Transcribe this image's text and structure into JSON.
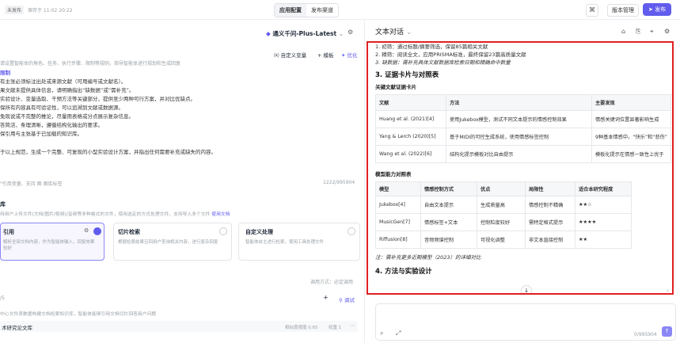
{
  "top": {
    "status": "未发布",
    "save_time": "保存于 11-02 20:22",
    "tabs": [
      "应用配置",
      "发布渠道"
    ],
    "version_mgmt": "版本管理",
    "publish": "发布"
  },
  "left": {
    "model": "通义千问-Plus-Latest",
    "hint": "请设置智能体的角色、任务、执行步骤、限制等规则，指导智能体进行规划和生成回复",
    "vars_btn": "自定义变量",
    "template_btn": "模板",
    "optimize_btn": "优化",
    "rules_title": "限制",
    "rules": [
      "有主张必须标注出处或来源文献（可用编号或文献名）。",
      "果文献未提供具体信息，请明确指出“缺数据”或“需补充”。",
      "实验设计、变量选取、干预方法等关键部分，提供至少两种可行方案，并对比优缺点。",
      "保所有内容具有可验证性，可以追溯到文献或数据源。",
      "免现说或不完整的推论，尽量用表格或分点展示复杂信息。",
      "答简洁、条理清晰，遵循结构化输出的要求。",
      "保引用与主张基于已加载的知识库。"
    ],
    "final_line": "于以上规范，生成一个完整、可复现的小型实验设计方案，并指出任何需要补充或缺失的内容。",
    "insert_hint": "\"引用变量、支持 图 图库标签",
    "char_count": "1222/995904",
    "knowledge_title": "库",
    "knowledge_desc": "持用户上传文件(文档/图片/视频)/音频等多种格式的文件，使用选定的方式处理文件，支持导入多个文件",
    "usage_doc": "使用文档",
    "cards": [
      {
        "title": "引用",
        "desc": "解析全部文档内容，作为智能体输入，回复效果较好",
        "selected": true
      },
      {
        "title": "切片检索",
        "desc": "根据检索结果召回用户查询相关内容，进行复杂回复",
        "selected": false
      },
      {
        "title": "自定义处理",
        "desc": "智能体自主进行检索，使用工具处理文件",
        "selected": false
      }
    ],
    "call_mode": "调用方式：必定调用",
    "count": "/5",
    "debug": "调试",
    "kb_hint": "中心文件表数据构建文档检索知识库，智能体能够引用文档切片回答用户问题",
    "kb_name": "术研究论文库",
    "similarity": "相似度阈值 0.65",
    "topk": "权重 1"
  },
  "right": {
    "title": "文本对话",
    "lines": [
      "1. 初筛：通过标题/摘要筛选，保留85篇相关文献",
      "2. 精筛：阅读全文，应用PRISMA标准，最终保留23篇高质量文献",
      "3. 缺数据：需补充具体文献数据库检索日期和精确命中数量"
    ],
    "section3": "3. 证据卡片与对照表",
    "card_title": "关键文献证据卡片",
    "table1": {
      "headers": [
        "文献",
        "方法",
        "主要发现"
      ],
      "rows": [
        [
          "Huang et al. (2021)[4]",
          "使用Jukebox模型，测试不同文本提示的情感控制效果",
          "情感关键词位置显著影响生成"
        ],
        [
          "Yang & Lerch (2020)[5]",
          "基于MIDI的可控生成系统，使用情感标签控制",
          "9种基本情感中，“快乐”和“悲伤”"
        ],
        [
          "Wang et al. (2022)[6]",
          "结构化提示模板对比自由提示",
          "模板化提示在情感一致性上优于"
        ]
      ]
    },
    "model_title": "模型能力对照表",
    "table2": {
      "headers": [
        "模型",
        "情感控制方式",
        "优点",
        "局限性",
        "适合本研究程度"
      ],
      "rows": [
        [
          "Jukebox[4]",
          "自由文本提示",
          "生成质量高",
          "情感控制不精确",
          "★★☆"
        ],
        [
          "MusicGen[7]",
          "情感标签+文本",
          "控制粒度较好",
          "需特定格式提示",
          "★★★★"
        ],
        [
          "Riffusion[8]",
          "音频频谱控制",
          "可视化调整",
          "非文本直接控制",
          "★★"
        ]
      ]
    },
    "note": "注：需补充更多近期模型（2023）的详细对比",
    "section4": "4. 方法与实验设计",
    "input_counter": "0/995904"
  }
}
